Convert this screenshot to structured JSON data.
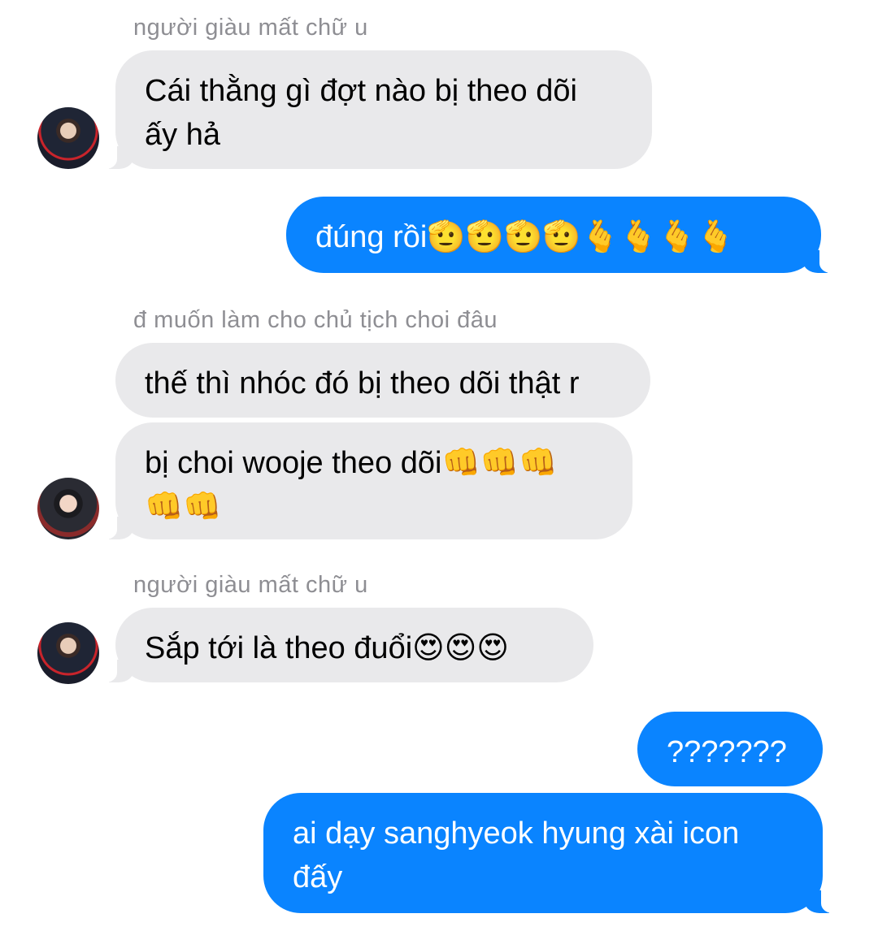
{
  "messages": [
    {
      "type": "sender",
      "text": "người giàu mất chữ u"
    },
    {
      "type": "received",
      "text": "Cái thằng gì đợt nào bị theo dõi\nấy hả"
    },
    {
      "type": "sent",
      "text": "đúng rồi🫡🫡🫡🫡🫰🫰🫰🫰"
    },
    {
      "type": "sender",
      "text": "đ muốn làm cho chủ tịch choi đâu"
    },
    {
      "type": "received",
      "text": "thế thì nhóc đó bị theo dõi thật r"
    },
    {
      "type": "received",
      "text": "bị choi wooje theo dõi👊👊👊\n👊👊"
    },
    {
      "type": "sender",
      "text": "người giàu mất chữ u"
    },
    {
      "type": "received",
      "text": "Sắp tới là theo đuổi😍😍😍"
    },
    {
      "type": "sent",
      "text": "???????"
    },
    {
      "type": "sent",
      "text": "ai dạy sanghyeok hyung xài icon\nđấy"
    }
  ],
  "avatars": [
    "avatar-sanghyeok",
    "avatar-wooje",
    "avatar-sanghyeok"
  ],
  "colors": {
    "received_bubble": "#e9e9eb",
    "sent_bubble": "#0a84ff",
    "sender_name": "#8e8e93"
  }
}
